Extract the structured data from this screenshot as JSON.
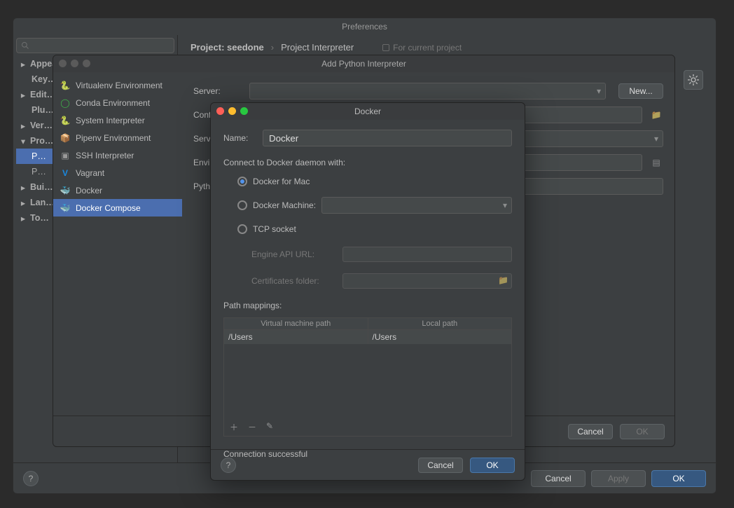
{
  "prefs": {
    "title": "Preferences",
    "breadcrumb_project": "Project: seedone",
    "breadcrumb_page": "Project Interpreter",
    "hint": "For current project",
    "tree": {
      "appearance": "Appearance & Behavior",
      "keymap": "Key…",
      "editor": "Edit…",
      "plugins": "Plu…",
      "version_control": "Ver…",
      "project": "Pro…",
      "p1": "P…",
      "p2": "P…",
      "build": "Bui…",
      "languages": "Lan…",
      "tools": "To…"
    },
    "footer": {
      "cancel": "Cancel",
      "apply": "Apply",
      "ok": "OK"
    }
  },
  "addpy": {
    "title": "Add Python Interpreter",
    "envs": {
      "virtualenv": "Virtualenv Environment",
      "conda": "Conda Environment",
      "system": "System Interpreter",
      "pipenv": "Pipenv Environment",
      "ssh": "SSH Interpreter",
      "vagrant": "Vagrant",
      "docker": "Docker",
      "compose": "Docker Compose"
    },
    "form": {
      "server_label": "Server:",
      "new_btn": "New...",
      "config_label": "Conf…",
      "service_label": "Serv…",
      "env_label": "Envir…",
      "python_label": "Pyth…"
    },
    "footer": {
      "cancel": "Cancel",
      "ok": "OK"
    }
  },
  "docker": {
    "title": "Docker",
    "name_label": "Name:",
    "name_value": "Docker",
    "connect_label": "Connect to Docker daemon with:",
    "radio_mac": "Docker for Mac",
    "radio_machine": "Docker Machine:",
    "radio_tcp": "TCP socket",
    "engine_url_label": "Engine API URL:",
    "certs_label": "Certificates folder:",
    "path_mappings_label": "Path mappings:",
    "th_vm": "Virtual machine path",
    "th_local": "Local path",
    "row_vm": "/Users",
    "row_local": "/Users",
    "status": "Connection successful",
    "footer": {
      "cancel": "Cancel",
      "ok": "OK"
    }
  }
}
